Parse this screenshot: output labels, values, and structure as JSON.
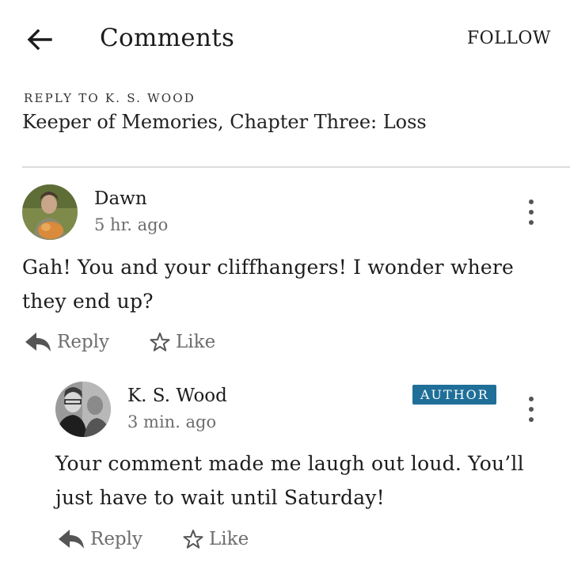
{
  "header": {
    "title": "Comments",
    "follow_label": "FOLLOW"
  },
  "context": {
    "reply_to": "REPLY TO K. S. WOOD",
    "story_title": "Keeper of Memories, Chapter Three: Loss"
  },
  "comments": [
    {
      "author": "Dawn",
      "time": "5 hr. ago",
      "text": "Gah! You and your cliffhangers! I wonder where they end up?",
      "reply_label": "Reply",
      "like_label": "Like"
    },
    {
      "author": "K. S. Wood",
      "badge": "AUTHOR",
      "time": "3 min. ago",
      "text": "Your comment made me laugh out loud. You’ll just have to wait until Saturday!",
      "reply_label": "Reply",
      "like_label": "Like"
    }
  ],
  "colors": {
    "badge_bg": "#1f6f99",
    "muted_text": "#6d6d6d",
    "divider": "#dcdcdc"
  }
}
